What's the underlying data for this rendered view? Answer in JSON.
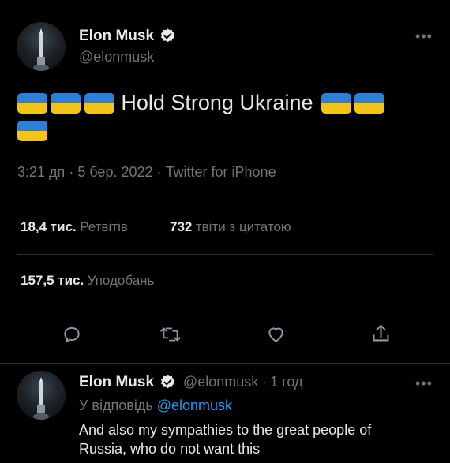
{
  "main_tweet": {
    "author_name": "Elon Musk",
    "author_handle": "@elonmusk",
    "text": "Hold Strong Ukraine",
    "flags_before": 3,
    "flags_after_line1": 2,
    "flags_line2": 1,
    "time": "3:21 дп",
    "date": "5 бер. 2022",
    "source": "Twitter for iPhone",
    "retweets_count": "18,4 тис.",
    "retweets_label": "Ретвітів",
    "quotes_count": "732",
    "quotes_label": "твіти з цитатою",
    "likes_count": "157,5 тис.",
    "likes_label": "Уподобань",
    "more_icon": "•••"
  },
  "reply_tweet": {
    "author_name": "Elon Musk",
    "author_handle": "@elonmusk",
    "separator": "·",
    "age": "1 год",
    "replying_to_label": "У відповідь",
    "replying_to_handle": "@elonmusk",
    "text_line1": "And also my sympathies to the great people of",
    "text_line2": "Russia, who do not want this",
    "more_icon": "•••"
  },
  "colors": {
    "background": "#000000",
    "text": "#e7e9ea",
    "muted": "#71767b",
    "link": "#1d9bf0",
    "divider": "#2f3336",
    "flag_blue": "#2f7fd6",
    "flag_yellow": "#f3c318"
  },
  "actions": [
    "reply-icon",
    "retweet-icon",
    "like-icon",
    "share-icon"
  ]
}
